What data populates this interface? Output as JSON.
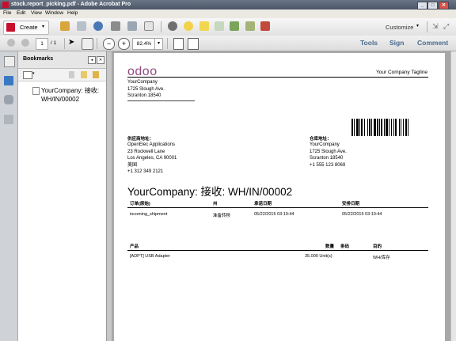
{
  "window": {
    "title": "stock.report_picking.pdf - Adobe Acrobat Pro",
    "btn_min": "_",
    "btn_max": "□",
    "btn_close": "✕"
  },
  "menu": [
    "File",
    "Edit",
    "View",
    "Window",
    "Help"
  ],
  "toolbar": {
    "create_label": "Create",
    "customize_label": "Customize",
    "page_current": "1",
    "page_total": "/ 1",
    "zoom_value": "82.4%"
  },
  "right_links": {
    "tools": "Tools",
    "sign": "Sign",
    "comment": "Comment"
  },
  "bookmarks": {
    "header": "Bookmarks",
    "items": [
      {
        "label_line1": "YourCompany: 接收:",
        "label_line2": "WH/IN/00002"
      }
    ]
  },
  "document": {
    "logo": "odoo",
    "tagline": "Your Company Tagline",
    "company_address": [
      "YourCompany",
      "1725 Slough Ave.",
      "Scranton 18540"
    ],
    "supplier_label": "供应商地址：",
    "supplier_address": [
      "OpenElec Applications",
      "23 Rockwell Lane",
      "Los Angeles, CA 90001",
      "美国",
      "+1 312 349 2121"
    ],
    "warehouse_label": "仓库地址：",
    "warehouse_address": [
      "YourCompany",
      "1725 Slough Ave.",
      "Scranton 18540",
      "+1 555 123 8069"
    ],
    "title": "YourCompany: 接收: WH/IN/00002",
    "info_headers": [
      "订单(原始)",
      "州",
      "承诺日期",
      "安排日期"
    ],
    "info_values": [
      "incoming_shipment",
      "准备转移",
      "05/22/2015 03:10:44",
      "05/22/2015 03:10:44"
    ],
    "line_headers": [
      "产品",
      "数量",
      "条码",
      "目的"
    ],
    "line_values": [
      "[ADPT] USB Adapter",
      "35.000 Unit(s)",
      "",
      "WH/库存"
    ]
  },
  "colors": {
    "odoo_brand": "#8f4b7f",
    "brand_link": "#4a6a8e",
    "titlebar": "#54607a"
  }
}
